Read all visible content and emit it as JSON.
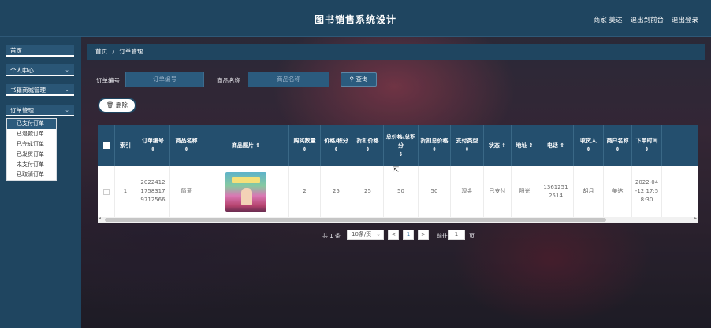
{
  "header": {
    "title": "图书销售系统设计",
    "user_role": "商家",
    "user_name": "美达",
    "back_label": "退出到前台",
    "logout_label": "退出登录"
  },
  "sidebar": {
    "items": [
      {
        "label": "首页",
        "has_chevron": false
      },
      {
        "label": "个人中心",
        "has_chevron": true
      },
      {
        "label": "书籍商城管理",
        "has_chevron": true
      },
      {
        "label": "订单管理",
        "has_chevron": true
      }
    ],
    "submenu": [
      {
        "label": "已支付订单",
        "active": true
      },
      {
        "label": "已退款订单",
        "active": false
      },
      {
        "label": "已完成订单",
        "active": false
      },
      {
        "label": "已发货订单",
        "active": false
      },
      {
        "label": "未支付订单",
        "active": false
      },
      {
        "label": "已取消订单",
        "active": false
      }
    ]
  },
  "breadcrumb": {
    "home": "首页",
    "separator": "/",
    "current": "订单管理"
  },
  "search": {
    "order_label": "订单编号",
    "order_placeholder": "订单编号",
    "product_label": "商品名称",
    "product_placeholder": "商品名称",
    "query_label": "查询"
  },
  "actions": {
    "delete_label": "删除"
  },
  "table": {
    "headers": [
      {
        "key": "index",
        "label": "索引",
        "sort": false
      },
      {
        "key": "order_no",
        "label": "订单编号",
        "sort": true
      },
      {
        "key": "product_name",
        "label": "商品名称",
        "sort": true
      },
      {
        "key": "product_image",
        "label": "商品图片",
        "sort": true
      },
      {
        "key": "qty",
        "label": "购买数量",
        "sort": true
      },
      {
        "key": "price",
        "label": "价格/积分",
        "sort": true
      },
      {
        "key": "discount_price",
        "label": "折扣价格",
        "sort": true
      },
      {
        "key": "total",
        "label": "总价格/总积分",
        "sort": true
      },
      {
        "key": "discount_total",
        "label": "折扣总价格",
        "sort": true
      },
      {
        "key": "pay_type",
        "label": "支付类型",
        "sort": true
      },
      {
        "key": "status",
        "label": "状态",
        "sort": true
      },
      {
        "key": "address",
        "label": "地址",
        "sort": true
      },
      {
        "key": "phone",
        "label": "电话",
        "sort": true
      },
      {
        "key": "receiver",
        "label": "收货人",
        "sort": true
      },
      {
        "key": "merchant",
        "label": "商户名称",
        "sort": true
      },
      {
        "key": "order_time",
        "label": "下单时间",
        "sort": true
      }
    ],
    "rows": [
      {
        "index": "1",
        "order_no": "2022412 1758317 9712566",
        "product_name": "简爱",
        "product_image": "book-cover",
        "qty": "2",
        "price": "25",
        "discount_price": "25",
        "total": "50",
        "discount_total": "50",
        "pay_type": "现金",
        "status": "已支付",
        "address": "阳光",
        "phone": "1361251 2514",
        "receiver": "胡月",
        "merchant": "美达",
        "order_time": "2022-04 -12 17:5 8:30"
      }
    ]
  },
  "pagination": {
    "total_text": "共 1 条",
    "page_size": "10条/页",
    "prev": "<",
    "current_page": "1",
    "next": ">",
    "goto_label": "前往",
    "goto_value": "1",
    "page_suffix": "页"
  },
  "colors": {
    "primary": "#1f4560",
    "header_bg": "#244f6e",
    "active_sub": "#2c5b7d"
  }
}
